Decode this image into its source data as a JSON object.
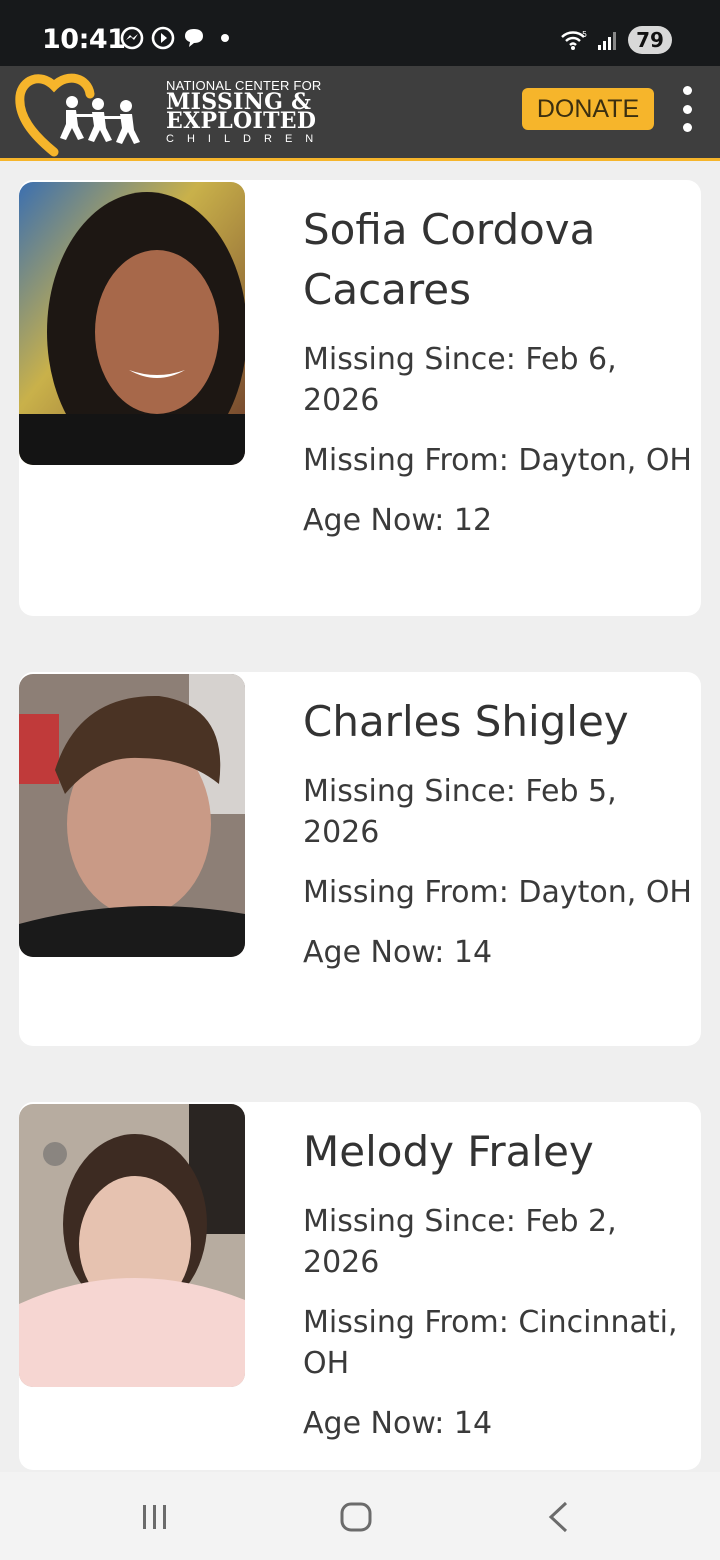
{
  "status_bar": {
    "time": "10:41",
    "battery": "79",
    "icons": [
      "messenger-icon",
      "chat-bubble-icon",
      "notification-dot-icon",
      "wifi-icon",
      "signal-icon"
    ]
  },
  "header": {
    "org_line1": "NATIONAL CENTER FOR",
    "org_line2": "MISSING &",
    "org_line3": "EXPLOITED",
    "org_line4": "CHILDREN",
    "donate_label": "DONATE",
    "accent_color": "#f6b52b",
    "background_color": "#3e3e3e"
  },
  "cases": [
    {
      "name": "Sofia Cordova Cacares",
      "missing_since": "Missing Since: Feb 6, 2026",
      "missing_from": "Missing From: Dayton, OH",
      "age_now": "Age Now: 12"
    },
    {
      "name": "Charles Shigley",
      "missing_since": "Missing Since: Feb 5, 2026",
      "missing_from": "Missing From: Dayton, OH",
      "age_now": "Age Now: 14"
    },
    {
      "name": "Melody Fraley",
      "missing_since": "Missing Since: Feb 2, 2026",
      "missing_from": "Missing From: Cincinnati, OH",
      "age_now": "Age Now: 14"
    }
  ],
  "nav": {
    "icons": [
      "recent-apps-icon",
      "home-icon",
      "back-icon"
    ]
  }
}
